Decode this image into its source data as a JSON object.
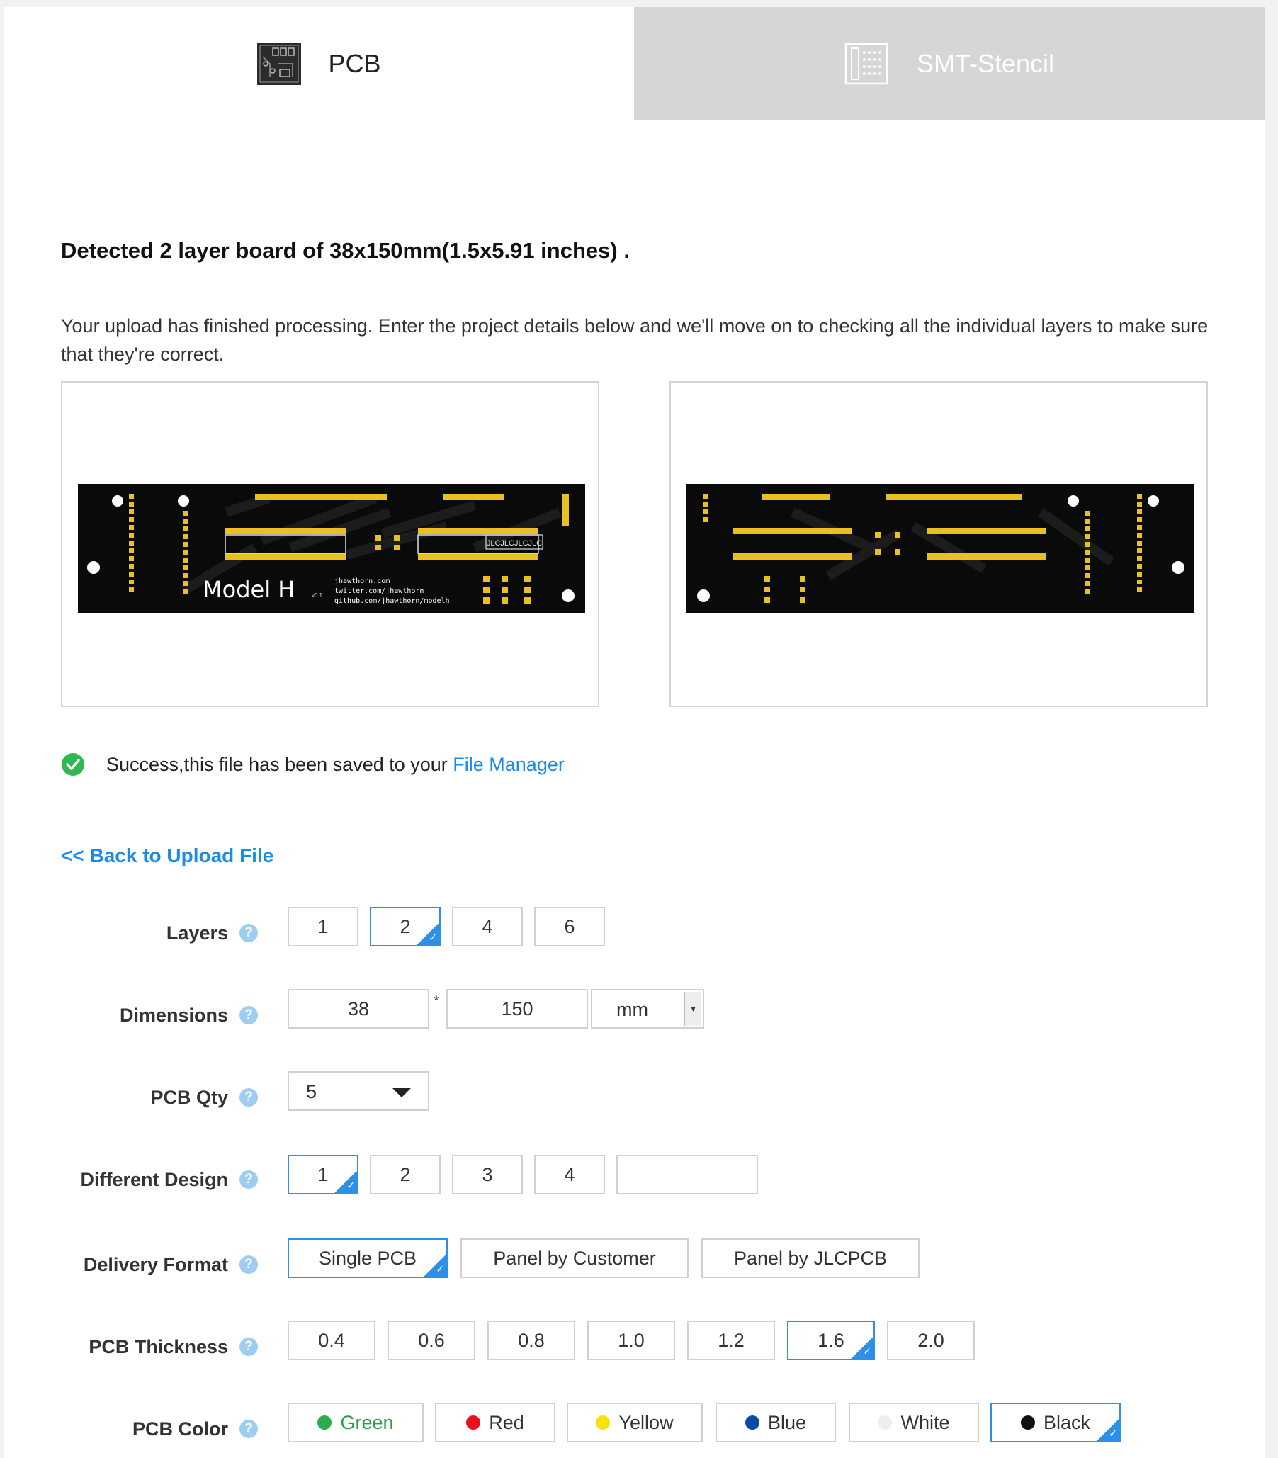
{
  "tabs": [
    {
      "label": "PCB",
      "icon": "pcb-board-icon",
      "active": true
    },
    {
      "label": "SMT-Stencil",
      "icon": "smt-stencil-icon",
      "active": false
    }
  ],
  "detected": "Detected 2 layer board of 38x150mm(1.5x5.91 inches) .",
  "description": "Your upload has finished processing. Enter the project details below and we'll move on to checking all the individual layers to make sure that they're correct.",
  "preview": {
    "top_silk": {
      "model_text": "Model  H",
      "version": "v0.1",
      "line1": "jhawthorn.com",
      "line2": "twitter.com/jhawthorn",
      "line3": "github.com/jhawthorn/modelh",
      "marker": "JLCJLCJLCJLC"
    }
  },
  "success": {
    "message": "Success,this file has been saved to your ",
    "link": "File Manager"
  },
  "back_link": "<< Back to Upload File",
  "form": {
    "help_glyph": "?",
    "layers": {
      "label": "Layers",
      "options": [
        "1",
        "2",
        "4",
        "6"
      ],
      "selected": "2"
    },
    "dimensions": {
      "label": "Dimensions",
      "width": "38",
      "sep": "*",
      "height": "150",
      "unit": "mm",
      "unit_arrow": "▾"
    },
    "qty": {
      "label": "PCB Qty",
      "value": "5"
    },
    "design": {
      "label": "Different Design",
      "options": [
        "1",
        "2",
        "3",
        "4"
      ],
      "selected": "1",
      "custom": ""
    },
    "delivery": {
      "label": "Delivery Format",
      "options": [
        "Single PCB",
        "Panel by Customer",
        "Panel by JLCPCB"
      ],
      "selected": "Single PCB"
    },
    "thickness": {
      "label": "PCB Thickness",
      "options": [
        "0.4",
        "0.6",
        "0.8",
        "1.0",
        "1.2",
        "1.6",
        "2.0"
      ],
      "selected": "1.6"
    },
    "color": {
      "label": "PCB Color",
      "options": [
        {
          "name": "Green",
          "dot": "#2eaa4f",
          "text": "#2e9e4a"
        },
        {
          "name": "Red",
          "dot": "#e8101e",
          "text": "#333333"
        },
        {
          "name": "Yellow",
          "dot": "#f5e30a",
          "text": "#333333"
        },
        {
          "name": "Blue",
          "dot": "#0b4aa5",
          "text": "#333333"
        },
        {
          "name": "White",
          "dot": "#eeeeee",
          "text": "#333333"
        },
        {
          "name": "Black",
          "dot": "#111111",
          "text": "#333333"
        }
      ],
      "selected": "Black"
    }
  },
  "colors": {
    "accent": "#2e8fe6",
    "link": "#1a8ce8",
    "pad": "#e8c020",
    "board": "#0a0a0a"
  }
}
